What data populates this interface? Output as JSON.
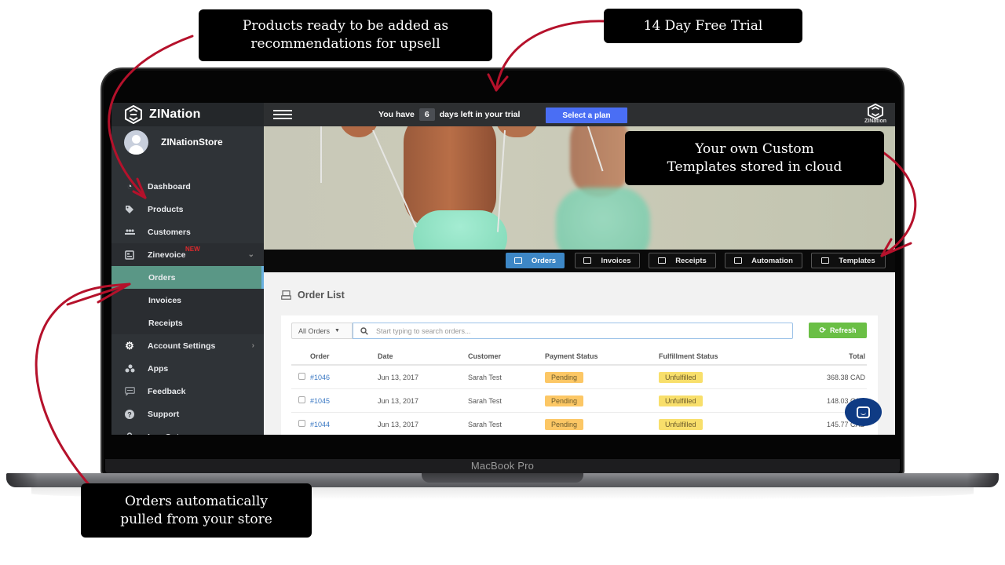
{
  "callouts": {
    "products_upsell": [
      "Products ready to be added as",
      "recommendations for upsell"
    ],
    "free_trial": "14 Day Free Trial",
    "custom_templates": [
      "Your own Custom",
      "Templates stored in cloud"
    ],
    "orders_pulled": [
      "Orders automatically",
      "pulled from your store"
    ]
  },
  "device": {
    "label": "MacBook Pro"
  },
  "colors": {
    "sidebar_bg": "#2f3337",
    "active_nav": "#5a9786",
    "plan_button": "#4a6ef4",
    "tab_active": "#3d87c6",
    "refresh_button": "#6abf45",
    "pending_pill": "#fcc765",
    "unfulfilled_pill": "#f8df6b",
    "arrow_red": "#b5112b",
    "chat_button": "#0f3b84"
  },
  "sidebar": {
    "brand": "ZINation",
    "store_name": "ZINationStore",
    "items": [
      {
        "label": "Dashboard",
        "icon": "dashboard-gauge-icon"
      },
      {
        "label": "Products",
        "icon": "tag-icon"
      },
      {
        "label": "Customers",
        "icon": "users-icon"
      },
      {
        "label": "Zinevoice",
        "icon": "invoice-icon",
        "badge": "NEW",
        "expanded": true,
        "children": [
          {
            "label": "Orders",
            "active": true
          },
          {
            "label": "Invoices"
          },
          {
            "label": "Receipts"
          }
        ]
      },
      {
        "label": "Account Settings",
        "icon": "gear-icon"
      },
      {
        "label": "Apps",
        "icon": "apps-icon"
      },
      {
        "label": "Feedback",
        "icon": "chat-bubble-icon"
      },
      {
        "label": "Support",
        "icon": "question-circle-icon"
      },
      {
        "label": "Log Out",
        "icon": "lock-icon"
      }
    ]
  },
  "topbar": {
    "trial_prefix": "You have",
    "trial_days": "6",
    "trial_suffix": "days left in your trial",
    "select_plan": "Select a plan",
    "logo_text": "ZINation"
  },
  "tabs": [
    {
      "label": "Orders",
      "active": true
    },
    {
      "label": "Invoices"
    },
    {
      "label": "Receipts"
    },
    {
      "label": "Automation"
    },
    {
      "label": "Templates"
    }
  ],
  "orders": {
    "title": "Order List",
    "filter": "All Orders",
    "search_placeholder": "Start typing to search orders...",
    "refresh": "Refresh",
    "columns": [
      "Order",
      "Date",
      "Customer",
      "Payment Status",
      "Fulfillment Status",
      "Total"
    ],
    "rows": [
      {
        "order": "#1046",
        "date": "Jun 13, 2017",
        "customer": "Sarah Test",
        "payment": "Pending",
        "fulfillment": "Unfulfilled",
        "total": "368.38 CAD"
      },
      {
        "order": "#1045",
        "date": "Jun 13, 2017",
        "customer": "Sarah Test",
        "payment": "Pending",
        "fulfillment": "Unfulfilled",
        "total": "148.03 CAD"
      },
      {
        "order": "#1044",
        "date": "Jun 13, 2017",
        "customer": "Sarah Test",
        "payment": "Pending",
        "fulfillment": "Unfulfilled",
        "total": "145.77 CAD"
      }
    ]
  }
}
